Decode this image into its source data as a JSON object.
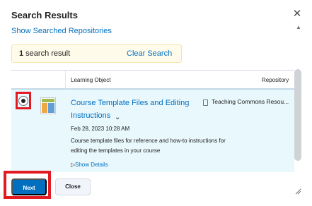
{
  "dialog": {
    "title": "Search Results",
    "close_icon": "close-icon"
  },
  "links": {
    "show_repos": "Show Searched Repositories"
  },
  "result_bar": {
    "count": "1",
    "count_suffix": " search result",
    "clear_label": "Clear Search"
  },
  "table": {
    "headers": [
      "Learning Object",
      "Repository"
    ],
    "rows": [
      {
        "selected": true,
        "thumbnail_icon": "document-thumbnail-icon",
        "title": "Course Template Files and Editing Instructions",
        "repository": "Teaching Commons Resou...",
        "repository_icon": "file-icon",
        "date": "Feb 28, 2023 10:28 AM",
        "description": "Course template files for reference and how-to instructions for editing the templates in your course",
        "details_label": "Show Details"
      }
    ]
  },
  "footer": {
    "next_label": "Next",
    "close_label": "Close"
  },
  "colors": {
    "link": "#006fbf",
    "primary_button": "#006fbf",
    "highlight": "#e21b22",
    "selected_row": "#e8f8fd"
  }
}
